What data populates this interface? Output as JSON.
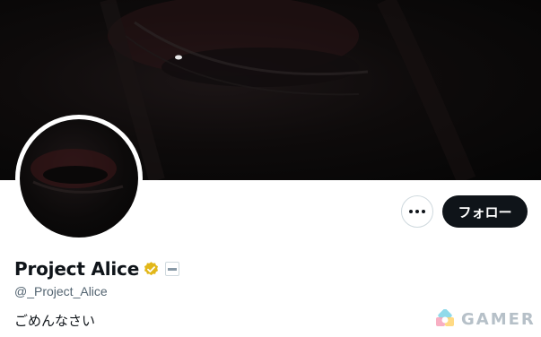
{
  "profile": {
    "display_name": "Project Alice",
    "handle": "@_Project_Alice",
    "bio": "ごめんなさい",
    "verified": true
  },
  "actions": {
    "more_icon": "more-horizontal-icon",
    "follow_label": "フォロー"
  },
  "watermark": {
    "text": "GAMER"
  },
  "colors": {
    "follow_button_bg": "#0f1419",
    "verified_badge": "#e2b719",
    "handle_text": "#536471",
    "watermark_text": "#b6c0c8"
  }
}
